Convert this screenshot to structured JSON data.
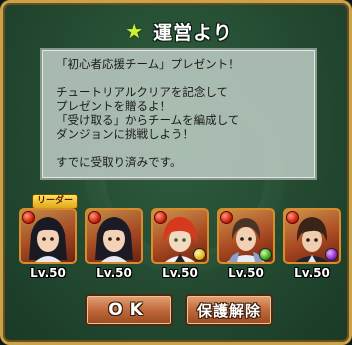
{
  "dialog": {
    "title": "運営より",
    "icon": "star-icon",
    "message_lines": [
      "「初心者応援チーム」プレゼント！",
      "",
      "チュートリアルクリアを記念して",
      "プレゼントを贈るよ！",
      "「受け取る」からチームを編成して",
      "ダンジョンに挑戦しよう！",
      "",
      "すでに受取り済みです。"
    ]
  },
  "team": {
    "leader_tag": "リーダー",
    "members": [
      {
        "level": "Lv.50",
        "main_attribute": "fire",
        "sub_attribute": "none"
      },
      {
        "level": "Lv.50",
        "main_attribute": "fire",
        "sub_attribute": "none"
      },
      {
        "level": "Lv.50",
        "main_attribute": "fire",
        "sub_attribute": "light"
      },
      {
        "level": "Lv.50",
        "main_attribute": "fire",
        "sub_attribute": "wood"
      },
      {
        "level": "Lv.50",
        "main_attribute": "fire",
        "sub_attribute": "dark"
      }
    ]
  },
  "buttons": {
    "ok_label": "OK",
    "unprotect_label": "保護解除"
  },
  "colors": {
    "frame_gold": "#c9a24a",
    "panel_green": "#234a31",
    "button_brown": "#c06a3c",
    "star_green": "#c7f23a"
  }
}
